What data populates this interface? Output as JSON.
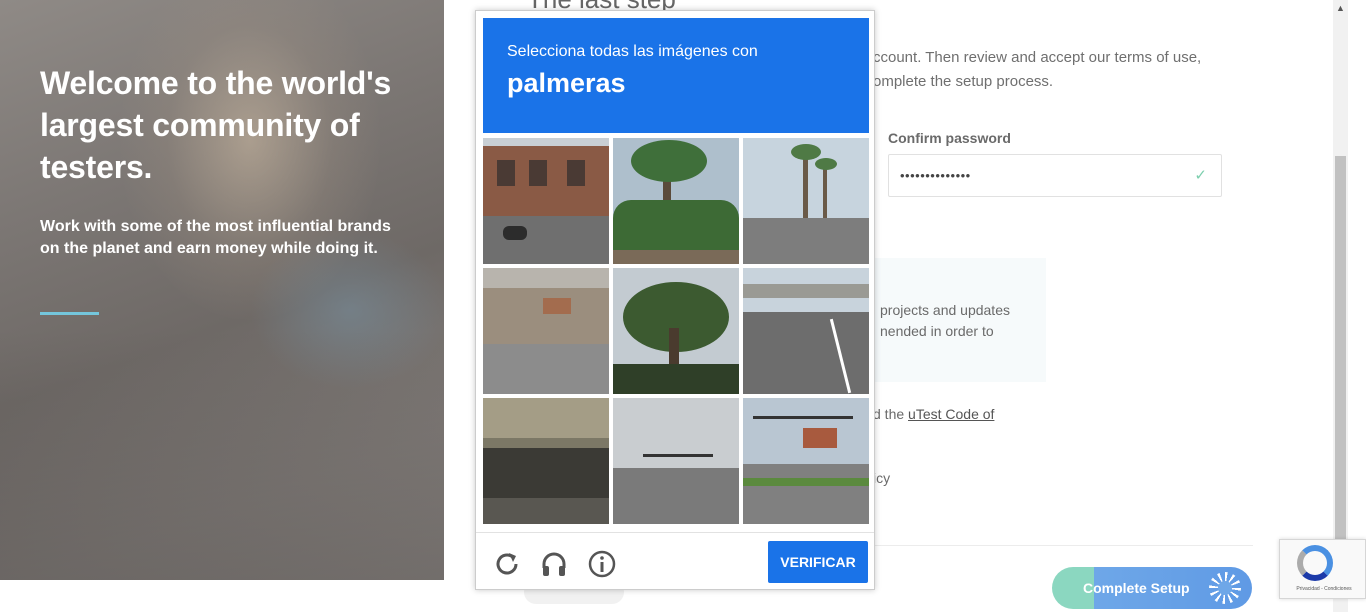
{
  "hero": {
    "heading": "Welcome to the world's largest community of testers.",
    "subheading": "Work with some of the most influential brands on the planet and earn money while doing it."
  },
  "form": {
    "title_fragment": "The last step",
    "intro_text": "ccount. Then review and accept our terms of use, omplete the setup process.",
    "confirm_password_label": "Confirm password",
    "confirm_password_value": "••••••••••••••",
    "info_text": "projects and updates nended in order to",
    "code_prefix": "d the ",
    "code_link": "uTest Code of",
    "privacy_fragment": "icy",
    "complete_button": "Complete Setup"
  },
  "captcha": {
    "instruction": "Selecciona todas las imágenes con",
    "target": "palmeras",
    "verify_button": "VERIFICAR",
    "tiles": [
      {
        "name": "brick-building-street"
      },
      {
        "name": "palm-tree-green"
      },
      {
        "name": "palm-lined-road"
      },
      {
        "name": "sidewalk-curb"
      },
      {
        "name": "palm-fronds-closeup"
      },
      {
        "name": "highway-overpass"
      },
      {
        "name": "bridge-underside"
      },
      {
        "name": "traffic-light-road"
      },
      {
        "name": "intersection-traffic-lights"
      }
    ],
    "icons": [
      "reload-icon",
      "audio-headphones-icon",
      "info-icon"
    ]
  },
  "badge": {
    "text": "Privacidad - Condiciones"
  }
}
